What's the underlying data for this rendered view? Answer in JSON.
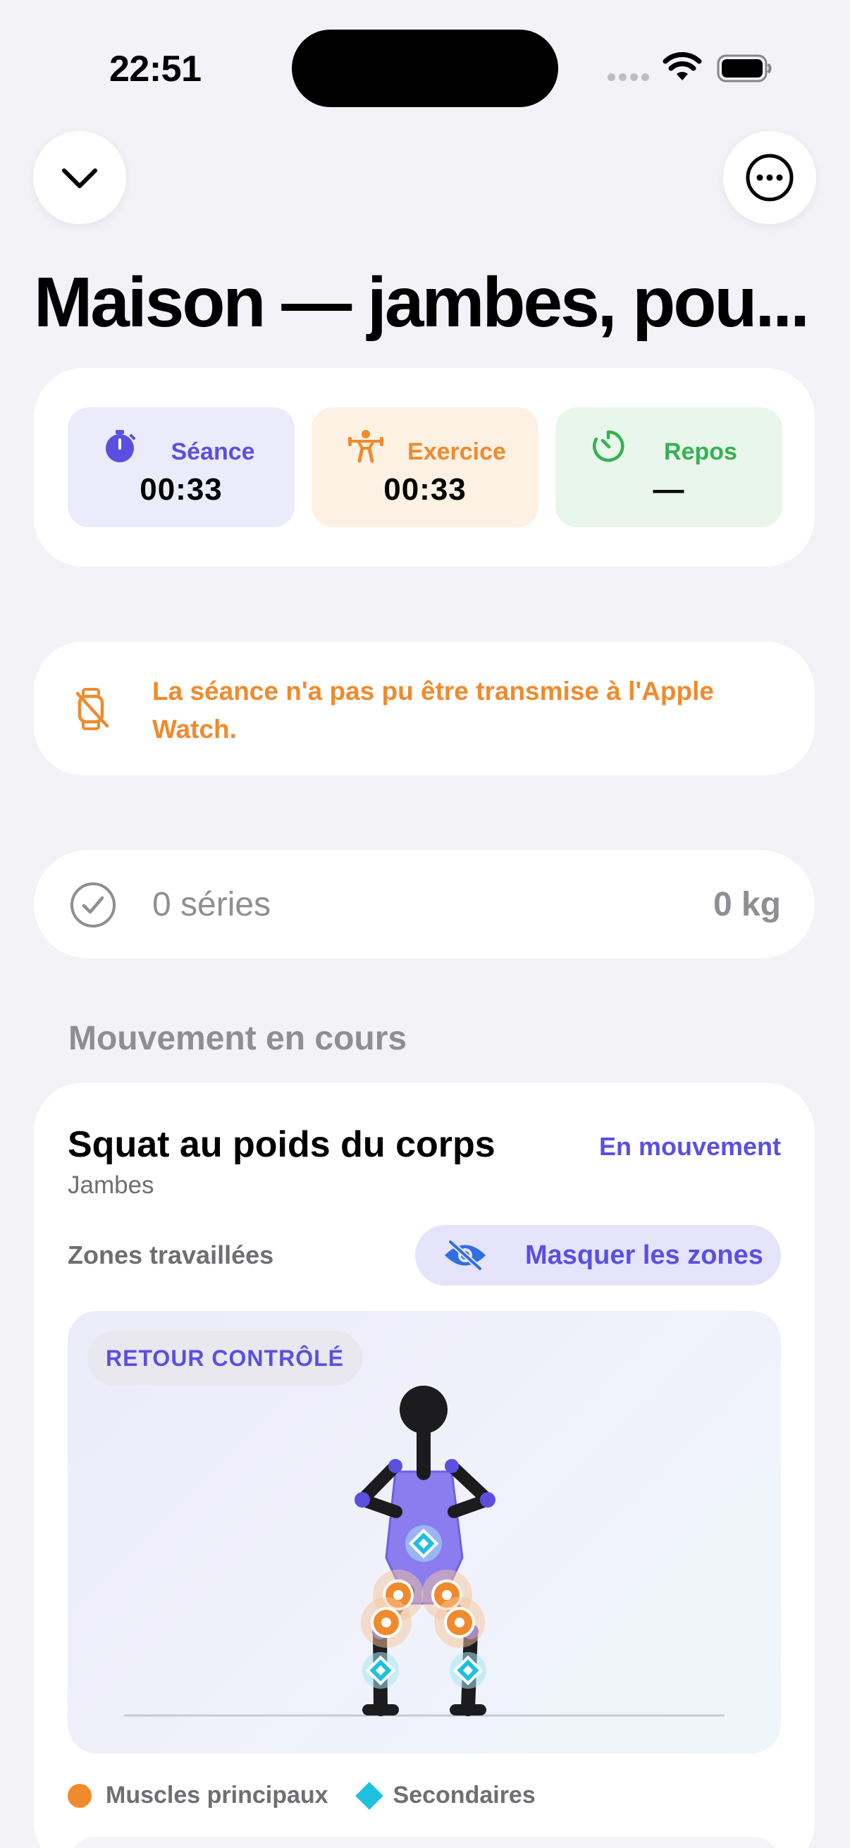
{
  "status_bar": {
    "time": "22:51"
  },
  "header": {
    "title": "Maison — jambes, pou..."
  },
  "timers": {
    "session": {
      "label": "Séance",
      "value": "00:33"
    },
    "exercise": {
      "label": "Exercice",
      "value": "00:33"
    },
    "rest": {
      "label": "Repos",
      "value": "—"
    }
  },
  "watch_warning": {
    "text": "La séance n'a pas pu être transmise à l'Apple Watch."
  },
  "series": {
    "count_label": "0 séries",
    "weight": "0 kg"
  },
  "current_movement": {
    "section_title": "Mouvement en cours",
    "exercise_name": "Squat au poids du corps",
    "muscle_group": "Jambes",
    "status": "En mouvement",
    "zones_label": "Zones travaillées",
    "zones_toggle_label": "Masquer les zones",
    "phase_badge": "RETOUR CONTRÔLÉ",
    "legend": {
      "primary": "Muscles principaux",
      "secondary": "Secondaires"
    }
  },
  "colors": {
    "accent": "#5b4fe0",
    "orange": "#f08a2c",
    "green": "#34b24f",
    "cyan": "#1ec0e0"
  },
  "icons": {
    "collapse": "chevron-down-icon",
    "more": "ellipsis-circle-icon",
    "session": "stopwatch-icon",
    "exercise": "weightlifter-icon",
    "rest": "timer-icon",
    "watch": "watch-slash-icon",
    "series": "checkmark-circle-icon",
    "zones": "eye-slash-icon"
  }
}
